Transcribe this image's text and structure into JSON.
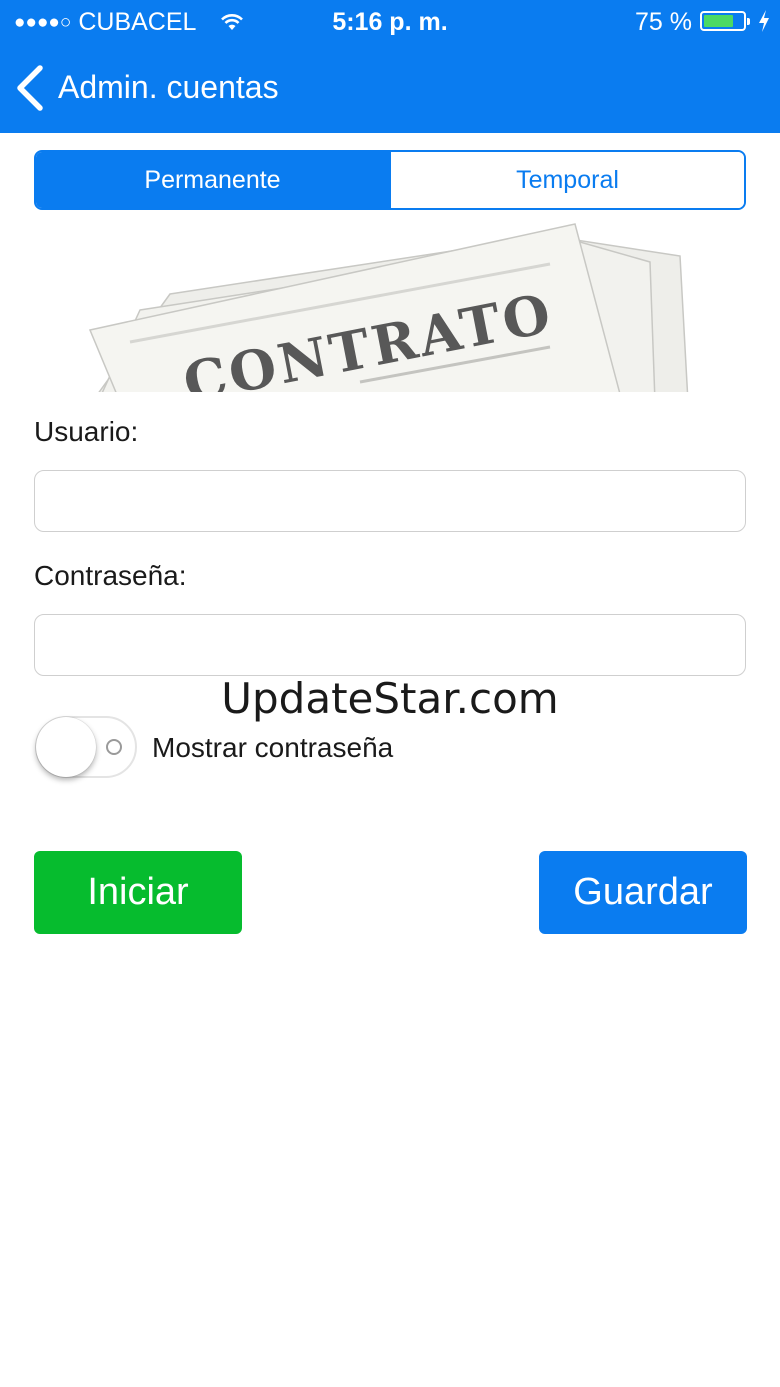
{
  "status_bar": {
    "signal_dots": "●●●●○",
    "carrier": "CUBACEL",
    "time": "5:16 p. m.",
    "battery_percent": "75 %",
    "battery_level": 0.75
  },
  "nav": {
    "back_icon": "chevron-left-icon",
    "title": "Admin. cuentas"
  },
  "segmented": {
    "options": [
      "Permanente",
      "Temporal"
    ],
    "selected": "Permanente"
  },
  "banner": {
    "text": "CONTRATO"
  },
  "form": {
    "usuario_label": "Usuario:",
    "usuario_value": "",
    "contrasena_label": "Contraseña:",
    "contrasena_value": ""
  },
  "watermark": "UpdateStar.com",
  "toggle": {
    "label": "Mostrar contraseña",
    "on": false
  },
  "buttons": {
    "iniciar": "Iniciar",
    "guardar": "Guardar"
  },
  "colors": {
    "primary": "#0a7cf0",
    "success": "#06bc2e",
    "battery": "#4cd964"
  }
}
